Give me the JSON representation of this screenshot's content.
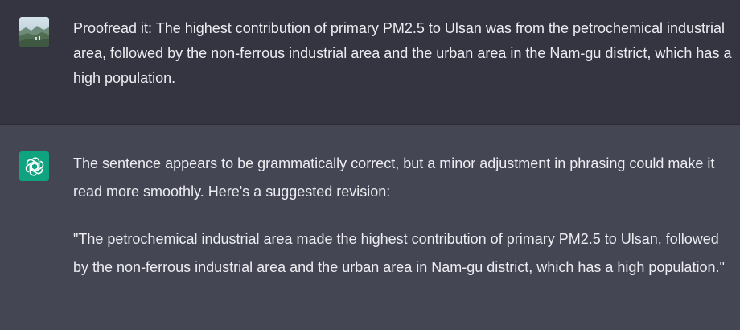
{
  "user_message": {
    "avatar_icon": "user-photo-icon",
    "text": "Proofread it: The highest contribution of primary PM2.5 to Ulsan was from the petrochemical industrial area, followed by the non-ferrous industrial area and the urban area in the Nam-gu district, which has a high population."
  },
  "assistant_message": {
    "avatar_icon": "openai-logo-icon",
    "avatar_color": "#10a37f",
    "paragraphs": [
      "The sentence appears to be grammatically correct, but a minor adjustment in phrasing could make it read more smoothly. Here's a suggested revision:",
      "\"The petrochemical industrial area made the highest contribution of primary PM2.5 to Ulsan, followed by the non-ferrous industrial area and the urban area in Nam-gu district, which has a high population.\""
    ]
  },
  "colors": {
    "user_bg": "#343541",
    "assistant_bg": "#444654",
    "text": "#ececf1"
  }
}
